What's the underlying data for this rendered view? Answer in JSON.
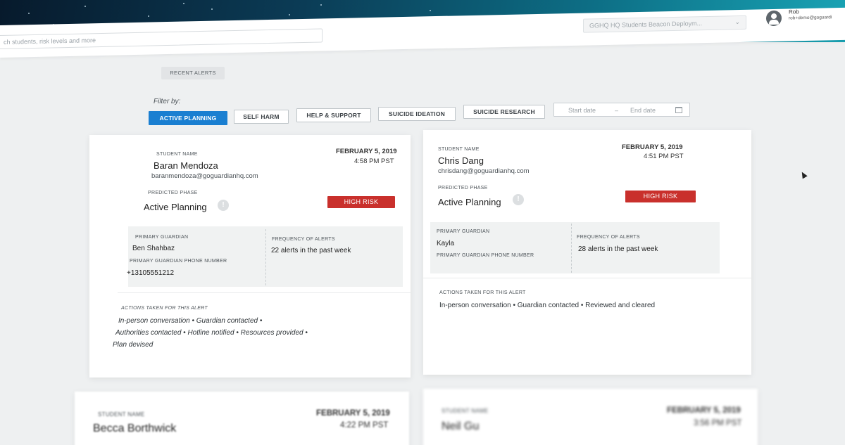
{
  "header": {
    "search_placeholder": "ch students, risk levels and more",
    "deployment_select": "GGHQ HQ Students Beacon Deploym...",
    "user_name": "Rob",
    "user_email": "rob+demo@goguardi"
  },
  "tabs": {
    "recent_alerts": "RECENT ALERTS"
  },
  "filters": {
    "label": "Filter by:",
    "chips": [
      "ACTIVE PLANNING",
      "SELF HARM",
      "HELP & SUPPORT",
      "SUICIDE IDEATION",
      "SUICIDE RESEARCH"
    ],
    "start_date": "Start date",
    "separator": "–",
    "end_date": "End date"
  },
  "labels": {
    "student_name": "STUDENT NAME",
    "predicted_phase": "PREDICTED PHASE",
    "primary_guardian": "PRIMARY GUARDIAN",
    "guardian_phone": "PRIMARY GUARDIAN PHONE NUMBER",
    "frequency": "FREQUENCY OF ALERTS",
    "actions_taken": "ACTIONS TAKEN FOR THIS ALERT"
  },
  "cards": [
    {
      "name": "Baran Mendoza",
      "email": "baranmendoza@goguardianhq.com",
      "date": "FEBRUARY 5, 2019",
      "time": "4:58 PM PST",
      "phase": "Active Planning",
      "risk": "HIGH RISK",
      "guardian": "Ben Shahbaz",
      "phone": "+13105551212",
      "frequency": "22 alerts in the past week",
      "actions_line1": "In-person conversation  •  Guardian contacted  •",
      "actions_line2": "Authorities contacted  •  Hotline notified  •  Resources provided  •",
      "actions_line3": "Plan devised"
    },
    {
      "name": "Chris Dang",
      "email": "chrisdang@goguardianhq.com",
      "date": "FEBRUARY 5, 2019",
      "time": "4:51 PM PST",
      "phase": "Active Planning",
      "risk": "HIGH RISK",
      "guardian": "Kayla",
      "phone": "",
      "frequency": "28 alerts in the past week",
      "actions_line1": "In-person conversation  •  Guardian contacted  •  Reviewed and cleared"
    },
    {
      "name": "Becca Borthwick",
      "date": "FEBRUARY 5, 2019",
      "time": "4:22 PM PST"
    },
    {
      "name": "Neil Gu",
      "date": "FEBRUARY 5, 2019",
      "time": "3:56 PM PST"
    }
  ],
  "colors": {
    "accent": "#1a7fd1",
    "risk": "#c9302c",
    "banner_dark": "#071a2c",
    "banner_light": "#19a3b4"
  }
}
